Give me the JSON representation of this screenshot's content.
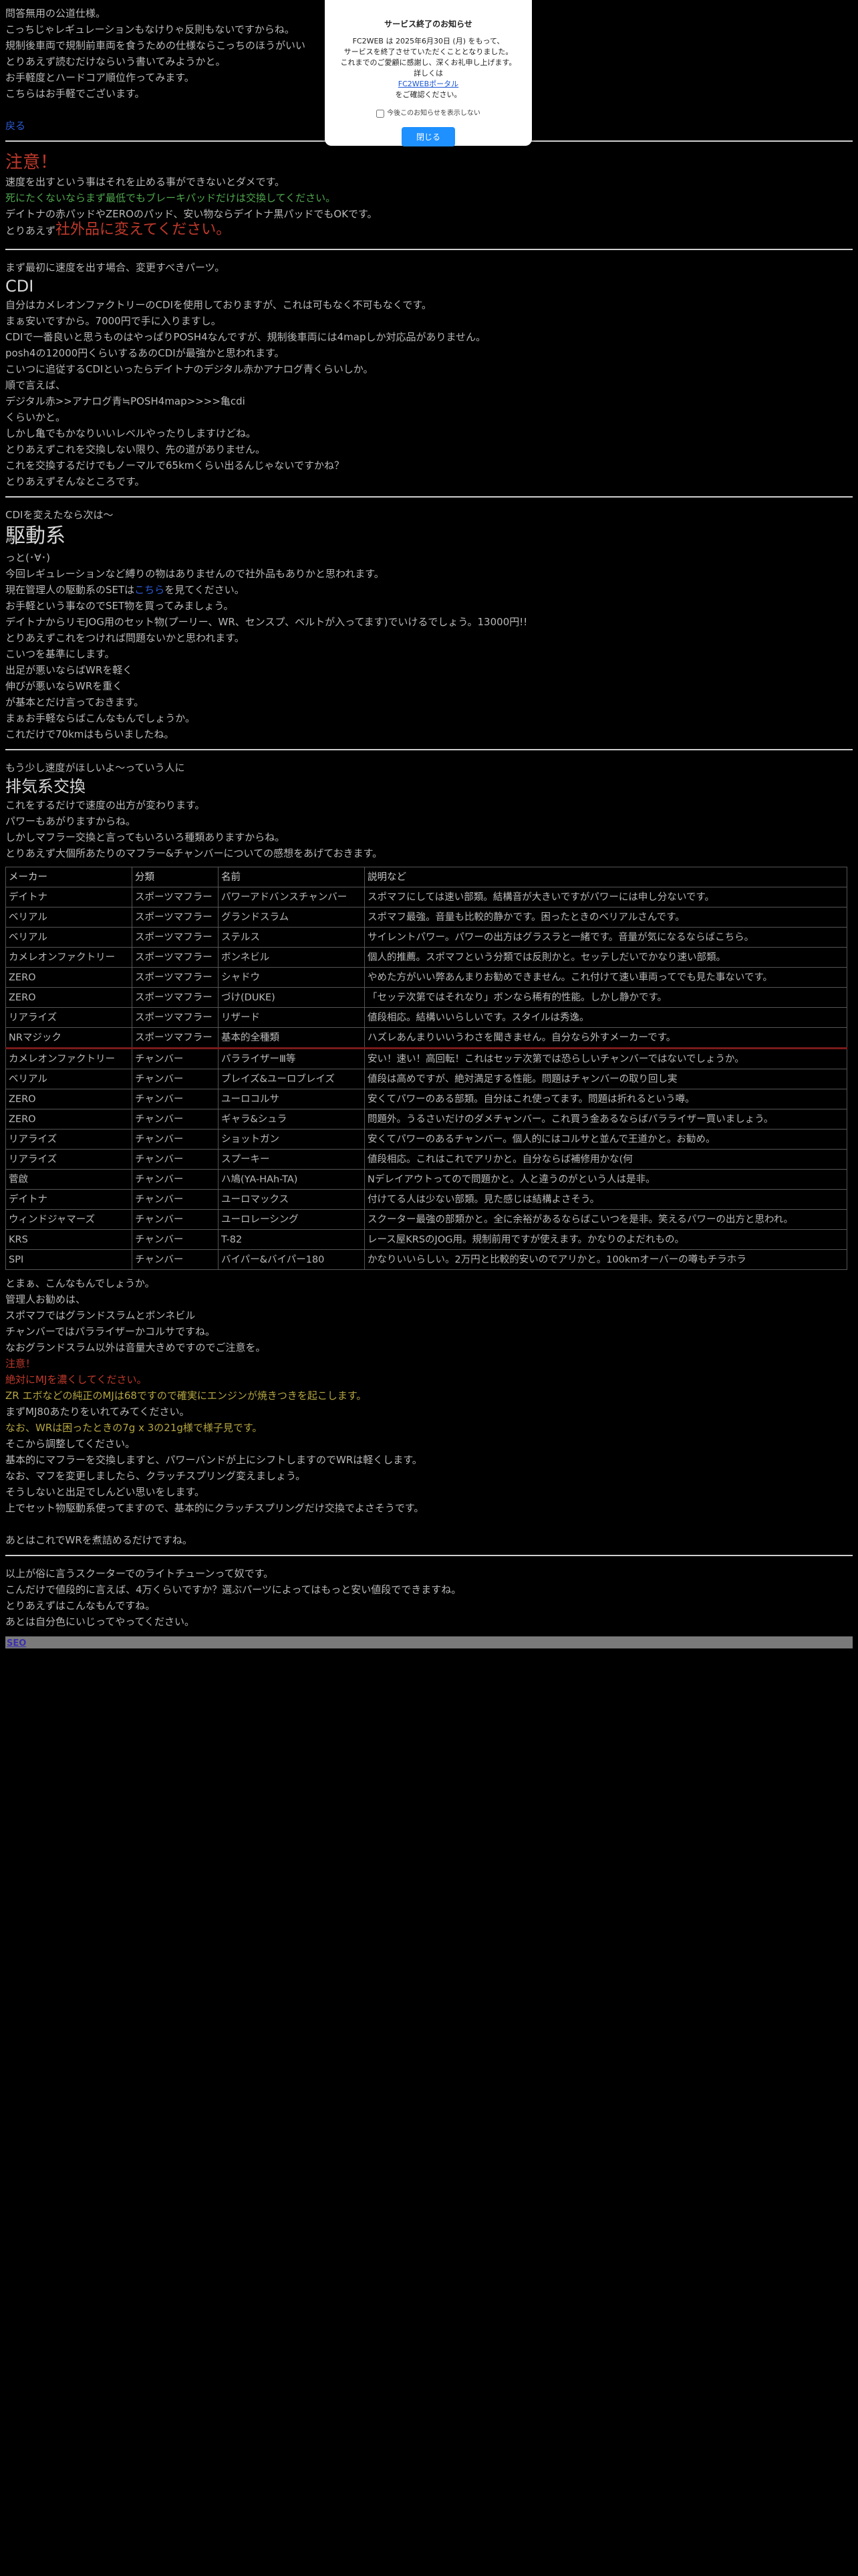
{
  "intro": {
    "lines": [
      "問答無用の公道仕様。",
      "こっちじゃレギュレーションもなけりゃ反則もないですからね。",
      "規制後車両で規制前車両を食うための仕様ならこっちのほうがいい",
      "とりあえず読むだけならいう書いてみようかと。",
      "お手軽度とハードコア順位作ってみます。",
      "こちらはお手軽でございます。"
    ],
    "back_link": "戻る"
  },
  "warning": {
    "title": "注意！",
    "lines": [
      "速度を出すという事はそれを止める事ができないとダメです。",
      "死にたくないならまず最低でもブレーキパッドだけは交換してください。",
      "デイトナの赤パッドやZEROのパッド、安い物ならデイトナ黒パッドでもOKです。"
    ],
    "last_prefix": "とりあえず",
    "last_emphasis": "社外品に変えてください。"
  },
  "cdi": {
    "lead": "まず最初に速度を出す場合、変更すべきパーツ。",
    "title": "CDI",
    "lines": [
      "自分はカメレオンファクトリーのCDIを使用しておりますが、これは可もなく不可もなくです。",
      "まぁ安いですから。7000円で手に入りますし。",
      "CDIで一番良いと思うものはやっぱりPOSH4なんですが、規制後車両には4mapしか対応品がありません。",
      "posh4の12000円くらいするあのCDIが最強かと思われます。",
      "こいつに追従するCDIといったらデイトナのデジタル赤かアナログ青くらいしか。",
      "順で言えば、",
      "デジタル赤>>アナログ青≒POSH4map>>>>亀cdi",
      "くらいかと。",
      "しかし亀でもかなりいいレベルやったりしますけどね。",
      "とりあえずこれを交換しない限り、先の道がありません。",
      "これを交換するだけでもノーマルで65kmくらい出るんじゃないですかね？",
      "とりあえずそんなところです。"
    ]
  },
  "drive": {
    "lead": "CDIを変えたなら次は〜",
    "title": "駆動系",
    "lines": [
      "っと(･∀･)",
      "今回レギュレーションなど縛りの物はありませんので社外品もありかと思われます。",
      "現在管理人の駆動系のSETは",
      "お手軽という事なのでSET物を買ってみましょう。",
      "デイトナからリモJOG用のセット物(プーリー、WR、センスプ、ベルトが入ってます)でいけるでしょう。13000円!!",
      "とりあえずこれをつければ問題ないかと思われます。",
      "こいつを基準にします。",
      "出足が悪いならばWRを軽く",
      "伸びが悪いならWRを重く",
      "が基本とだけ言っておきます。",
      "まぁお手軽ならばこんなもんでしょうか。",
      "これだけで70kmはもらいましたね。"
    ],
    "set_link": "こちら",
    "set_suffix": "を見てください。"
  },
  "exhaust": {
    "lead": "もう少し速度がほしいよ〜っていう人に",
    "title": "排気系交換",
    "lines": [
      "これをするだけで速度の出方が変わります。",
      "パワーもあがりますからね。",
      "しかしマフラー交換と言ってもいろいろ種類ありますからね。",
      "とりあえず大個所あたりのマフラー&チャンバーについての感想をあげておきます。"
    ]
  },
  "table": {
    "headers": [
      "メーカー",
      "分類",
      "名前",
      "説明など"
    ],
    "rows": [
      [
        "デイトナ",
        "スポーツマフラー",
        "パワーアドバンスチャンバー",
        "スポマフにしては速い部類。結構音が大きいですがパワーには申し分ないです。"
      ],
      [
        "ベリアル",
        "スポーツマフラー",
        "グランドスラム",
        "スポマフ最強。音量も比較的静かです。困ったときのベリアルさんです。"
      ],
      [
        "ベリアル",
        "スポーツマフラー",
        "ステルス",
        "サイレントパワー。パワーの出方はグラスラと一緒です。音量が気になるならばこちら。"
      ],
      [
        "カメレオンファクトリー",
        "スポーツマフラー",
        "ボンネビル",
        "個人的推薦。スポマフという分類では反則かと。セッテしだいでかなり速い部類。"
      ],
      [
        "ZERO",
        "スポーツマフラー",
        "シャドウ",
        "やめた方がいい弊あんまりお勧めできません。これ付けて速い車両ってでも見た事ないです。"
      ],
      [
        "ZERO",
        "スポーツマフラー",
        "づけ(DUKE)",
        "「セッテ次第ではそれなり」ボンなら稀有的性能。しかし静かです。"
      ],
      [
        "リアライズ",
        "スポーツマフラー",
        "リザード",
        "値段相応。結構いいらしいです。スタイルは秀逸。"
      ],
      [
        "NRマジック",
        "スポーツマフラー",
        "基本的全種類",
        "ハズレあんまりいいうわさを聞きません。自分なら外すメーカーです。"
      ],
      [
        "カメレオンファクトリー",
        "チャンバー",
        "パラライザーⅢ等",
        "安い！速い！高回転！これはセッテ次第では恐らしいチャンバーではないでしょうか。"
      ],
      [
        "ベリアル",
        "チャンバー",
        "ブレイズ&ユーロブレイズ",
        "値段は高めですが、絶対満足する性能。問題はチャンバーの取り回し実"
      ],
      [
        "ZERO",
        "チャンバー",
        "ユーロコルサ",
        "安くてパワーのある部類。自分はこれ使ってます。問題は折れるという噂。"
      ],
      [
        "ZERO",
        "チャンバー",
        "ギャラ&シュラ",
        "問題外。うるさいだけのダメチャンバー。これ買う金あるならばパラライザー買いましょう。"
      ],
      [
        "リアライズ",
        "チャンバー",
        "ショットガン",
        "安くてパワーのあるチャンバー。個人的にはコルサと並んで王道かと。お勧め。"
      ],
      [
        "リアライズ",
        "チャンバー",
        "スプーキー",
        "値段相応。これはこれでアリかと。自分ならば補修用かな(何"
      ],
      [
        "菅啟",
        "チャンバー",
        "ハ鳩(YA-HAh-TA)",
        "Nデレイアウトってので問題かと。人と違うのがという人は是非。"
      ],
      [
        "デイトナ",
        "チャンバー",
        "ユーロマックス",
        "付けてる人は少ない部類。見た感じは結構よさそう。"
      ],
      [
        "ウィンドジャマーズ",
        "チャンバー",
        "ユーロレーシング",
        "スクーター最強の部類かと。全に余裕があるならばこいつを是非。笑えるパワーの出方と思われ。"
      ],
      [
        "KRS",
        "チャンバー",
        "T-82",
        "レース屋KRSのJOG用。規制前用ですが使えます。かなりのよだれもの。"
      ],
      [
        "SPI",
        "チャンバー",
        "バイパー&バイパー180",
        "かなりいいらしい。2万円と比較的安いのでアリかと。100kmオーバーの噂もチラホラ"
      ]
    ]
  },
  "summary": {
    "lines_a": [
      "とまぁ、こんなもんでしょうか。",
      "管理人お勧めは、",
      "スポマフではグランドスラムとボンネビル",
      "チャンバーではパラライザーかコルサですね。",
      "なおグランドスラム以外は音量大きめですのでご注意を。"
    ],
    "note_title": "注意！",
    "note_line": "絶対にMJを濃くしてください。",
    "olive_line_1": "ZR エボなどの純正のMJは68ですので確実にエンジンが焼きつきを起こします。",
    "lines_b": [
      "まずMJ80あたりをいれてみてください。"
    ],
    "olive_line_2": "なお、WRは困ったときの7g x 3の21g様で様子見です。",
    "lines_c": [
      "そこから調整してください。",
      "基本的にマフラーを交換しますと、パワーバンドが上にシフトしますのでWRは軽くします。",
      "なお、マフを変更しましたら、クラッチスプリング変えましょう。",
      "そうしないと出足でしんどい思いをします。",
      "上でセット物駆動系使ってますので、基本的にクラッチスプリングだけ交換でよさそうです。"
    ],
    "closing": "あとはこれでWRを煮詰めるだけですね。"
  },
  "outro": {
    "lines": [
      "以上が俗に言うスクーターでのライトチューンって奴です。",
      "こんだけで値段的に言えば、4万くらいですか？選ぶパーツによってはもっと安い値段でできますね。",
      "とりあえずはこんなもんですね。",
      "あとは自分色にいじってやってください。"
    ]
  },
  "footer": {
    "seo_link": "SEO"
  },
  "modal": {
    "title": "サービス終了のお知らせ",
    "body": [
      "FC2WEB は 2025年6月30日 (月) をもって、",
      "サービスを終了させていただくこととなりました。",
      "これまでのご愛顧に感謝し、深くお礼申し上げます。"
    ],
    "detail_prefix": "詳しくは ",
    "detail_link": "FC2WEBポータル",
    "detail_suffix": " をご確認ください。",
    "checkbox_label": "今後このお知らせを表示しない",
    "close_label": "閉じる"
  },
  "colors": {
    "background": "#000000",
    "text": "#b8b8b8",
    "warning_red": "#c0392b",
    "note_green": "#4fa84f",
    "note_olive": "#b5a642",
    "link_blue": "#2c5bd6",
    "modal_button": "#1e90ff"
  }
}
